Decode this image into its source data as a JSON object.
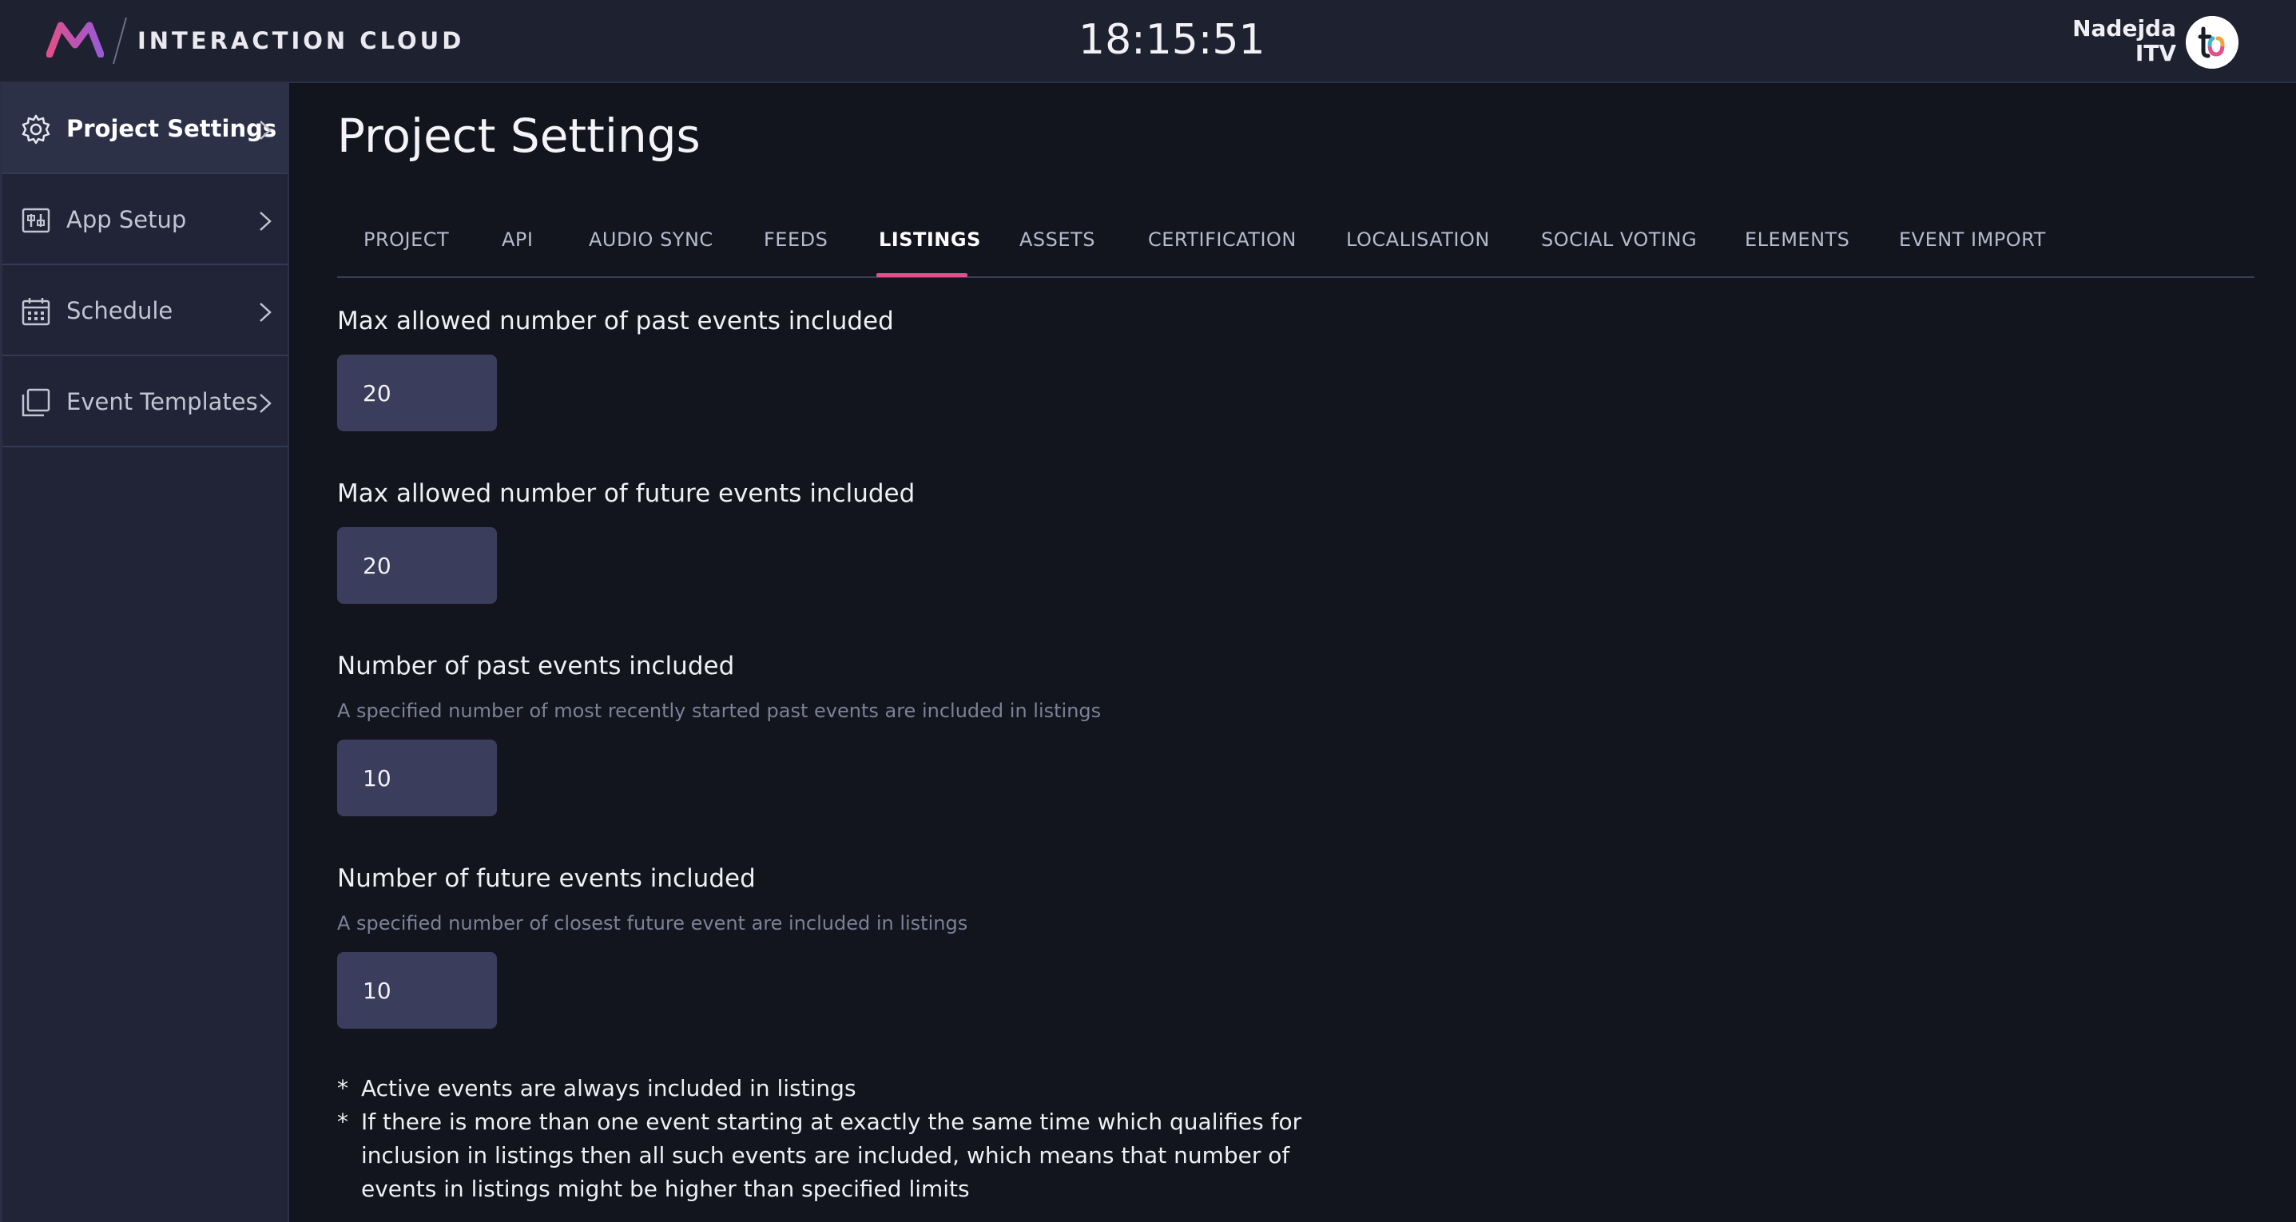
{
  "header": {
    "brand": "INTERACTION CLOUD",
    "clock": "18:15:51",
    "user_name": "Nadejda",
    "user_org": "ITV"
  },
  "sidebar": {
    "items": [
      {
        "label": "Project Settings",
        "icon": "gear-icon",
        "active": true
      },
      {
        "label": "App Setup",
        "icon": "app-setup-icon",
        "active": false
      },
      {
        "label": "Schedule",
        "icon": "calendar-icon",
        "active": false
      },
      {
        "label": "Event Templates",
        "icon": "copy-icon",
        "active": false
      }
    ]
  },
  "main": {
    "title": "Project Settings",
    "tabs": [
      {
        "label": "PROJECT"
      },
      {
        "label": "API"
      },
      {
        "label": "AUDIO SYNC"
      },
      {
        "label": "FEEDS"
      },
      {
        "label": "LISTINGS",
        "active": true
      },
      {
        "label": "ASSETS"
      },
      {
        "label": "CERTIFICATION"
      },
      {
        "label": "LOCALISATION"
      },
      {
        "label": "SOCIAL VOTING"
      },
      {
        "label": "ELEMENTS"
      },
      {
        "label": "EVENT IMPORT"
      }
    ],
    "fields": [
      {
        "label": "Max allowed number of past events included",
        "help": "",
        "value": "20"
      },
      {
        "label": "Max allowed number of future events included",
        "help": "",
        "value": "20"
      },
      {
        "label": "Number of past events included",
        "help": "A specified number of most recently started past events are included in listings",
        "value": "10"
      },
      {
        "label": "Number of future events included",
        "help": "A specified number of closest future event are included in listings",
        "value": "10"
      }
    ],
    "notes": [
      {
        "star": "*",
        "text": "Active events are always included in listings"
      },
      {
        "star": "*",
        "text": "If there is more than one event starting at exactly the same time which qualifies for inclusion in listings then all such events are included, which means that number of events in listings might be higher than specified limits"
      }
    ]
  },
  "colors": {
    "accent_pink": "#e0508a",
    "topbar_bg": "#1e2130",
    "sidebar_bg": "#202436",
    "content_bg": "#12141e",
    "input_bg": "#3a3e5c"
  }
}
